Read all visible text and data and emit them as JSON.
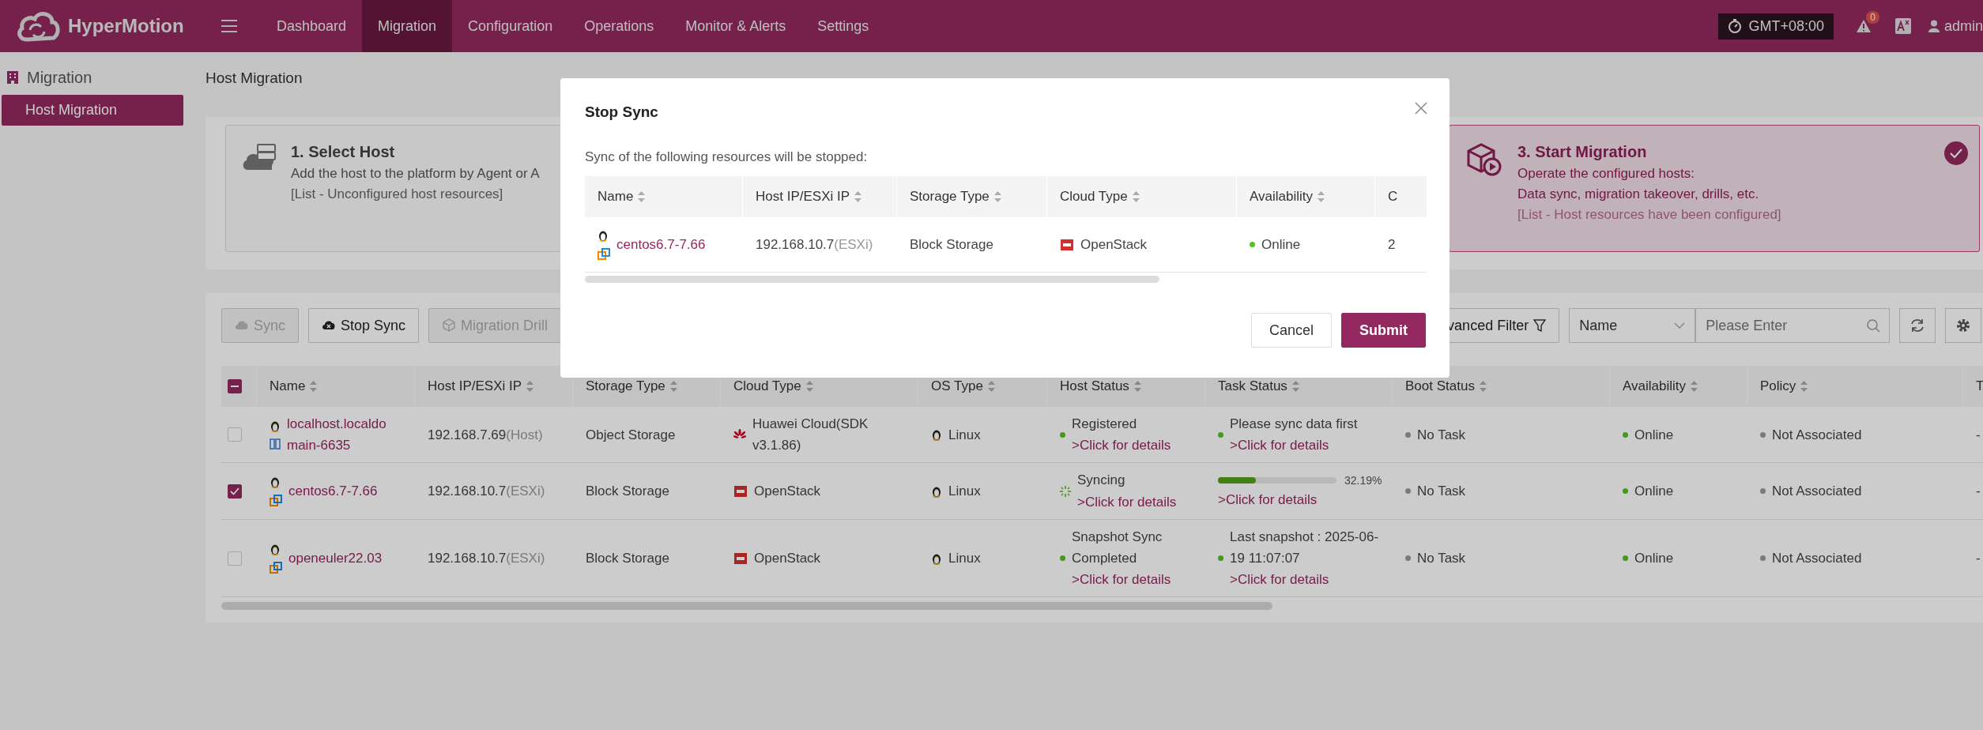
{
  "header": {
    "logo": "HyperMotion",
    "nav": [
      {
        "label": "Dashboard",
        "selected": false
      },
      {
        "label": "Migration",
        "selected": true
      },
      {
        "label": "Configuration",
        "selected": false
      },
      {
        "label": "Operations",
        "selected": false
      },
      {
        "label": "Monitor & Alerts",
        "selected": false
      },
      {
        "label": "Settings",
        "selected": false
      }
    ],
    "timezone": "GMT+08:00",
    "alert_count": "0",
    "user": "admin"
  },
  "sidebar": {
    "section": "Migration",
    "items": [
      {
        "label": "Host Migration",
        "selected": true
      }
    ]
  },
  "page_title": "Host Migration",
  "steps": [
    {
      "kind": "select",
      "title": "1. Select Host",
      "lines": [
        "Add the host to the platform by Agent or A"
      ],
      "note": "[List - Unconfigured host resources]",
      "selected": false
    },
    {
      "kind": "start",
      "title": "3. Start Migration",
      "lines": [
        "Operate the configured hosts:",
        "Data sync, migration takeover, drills, etc."
      ],
      "note": "[List - Host resources have been configured]",
      "selected": true
    }
  ],
  "toolbar": {
    "actions": [
      {
        "kind": "sync",
        "label": "Sync",
        "disabled": true
      },
      {
        "kind": "stop",
        "label": "Stop Sync",
        "disabled": false
      },
      {
        "kind": "drill",
        "label": "Migration Drill",
        "disabled": true
      }
    ],
    "filter": "vanced Filter",
    "field": {
      "value": "Name"
    },
    "search": {
      "placeholder": "Please Enter"
    }
  },
  "table": {
    "select_all": {
      "indeterminate": true
    },
    "columns": [
      {
        "label": "Name",
        "sortable": true
      },
      {
        "label": "Host IP/ESXi IP",
        "sortable": true
      },
      {
        "label": "Storage Type",
        "sortable": true
      },
      {
        "label": "Cloud Type",
        "sortable": true
      },
      {
        "label": "OS Type",
        "sortable": true
      },
      {
        "label": "Host Status",
        "sortable": true
      },
      {
        "label": "Task Status",
        "sortable": true
      },
      {
        "label": "Boot Status",
        "sortable": true
      },
      {
        "label": "Availability",
        "sortable": true
      },
      {
        "label": "Policy",
        "sortable": true
      },
      {
        "label": "T",
        "sortable": false
      }
    ],
    "rows": [
      {
        "checked": false,
        "kind": "host",
        "name": "localhost.localdomain-6635",
        "ip": "192.168.7.69",
        "ip_type": "(Host)",
        "storage": "Object Storage",
        "cloud": {
          "kind": "huawei",
          "label": "Huawei Cloud(SDK v3.1.86)"
        },
        "os": "Linux",
        "host_status": {
          "kind": "dot",
          "color": "#429d15",
          "text": "Registered",
          "link": ">Click for details"
        },
        "task_status": {
          "kind": "text",
          "color": "#429d15",
          "text": "Please sync data first",
          "link": ">Click for details"
        },
        "boot": {
          "color": "#7a7a7a",
          "text": "No Task"
        },
        "availability": {
          "color": "#429d15",
          "text": "Online"
        },
        "policy": {
          "color": "#7a7a7a",
          "text": "Not Associated"
        },
        "column_11": "-"
      },
      {
        "checked": true,
        "kind": "esxi",
        "name": "centos6.7-7.66",
        "ip": "192.168.10.7",
        "ip_type": "(ESXi)",
        "storage": "Block Storage",
        "cloud": {
          "kind": "openstack",
          "label": "OpenStack"
        },
        "os": "Linux",
        "host_status": {
          "kind": "spinner",
          "text": "Syncing",
          "link": ">Click for details"
        },
        "task_status": {
          "kind": "progress",
          "level": 0.3219,
          "reading": "32.19%",
          "link": ">Click for details"
        },
        "boot": {
          "color": "#7a7a7a",
          "text": "No Task"
        },
        "availability": {
          "color": "#429d15",
          "text": "Online"
        },
        "policy": {
          "color": "#7a7a7a",
          "text": "Not Associated"
        },
        "column_11": "-"
      },
      {
        "checked": false,
        "kind": "esxi",
        "name": "openeuler22.03",
        "ip": "192.168.10.7",
        "ip_type": "(ESXi)",
        "storage": "Block Storage",
        "cloud": {
          "kind": "openstack",
          "label": "OpenStack"
        },
        "os": "Linux",
        "host_status": {
          "kind": "dot",
          "color": "#429d15",
          "text": "Snapshot Sync Completed",
          "link": ">Click for details"
        },
        "task_status": {
          "kind": "text",
          "color": "#429d15",
          "text": "Last snapshot : 2025-06-19 11:07:07",
          "link": ">Click for details"
        },
        "boot": {
          "color": "#7a7a7a",
          "text": "No Task"
        },
        "availability": {
          "color": "#429d15",
          "text": "Online"
        },
        "policy": {
          "color": "#7a7a7a",
          "text": "Not Associated"
        },
        "column_11": "-"
      }
    ]
  },
  "modal": {
    "title": "Stop Sync",
    "message": "Sync of the following resources will be stopped:",
    "columns": [
      {
        "label": "Name",
        "sortable": true
      },
      {
        "label": "Host IP/ESXi IP",
        "sortable": true
      },
      {
        "label": "Storage Type",
        "sortable": true
      },
      {
        "label": "Cloud Type",
        "sortable": true
      },
      {
        "label": "Availability",
        "sortable": true
      },
      {
        "label": "C",
        "sortable": false
      }
    ],
    "rows": [
      {
        "kind": "esxi",
        "name": "centos6.7-7.66",
        "ip": "192.168.10.7",
        "ip_type": "(ESXi)",
        "storage": "Block Storage",
        "cloud": {
          "kind": "openstack",
          "label": "OpenStack"
        },
        "availability": {
          "color": "#52c41a",
          "text": "Online"
        },
        "column_6": "2"
      }
    ],
    "buttons": [
      {
        "kind": "secondary",
        "label": "Cancel"
      },
      {
        "kind": "primary",
        "label": "Submit"
      }
    ]
  }
}
